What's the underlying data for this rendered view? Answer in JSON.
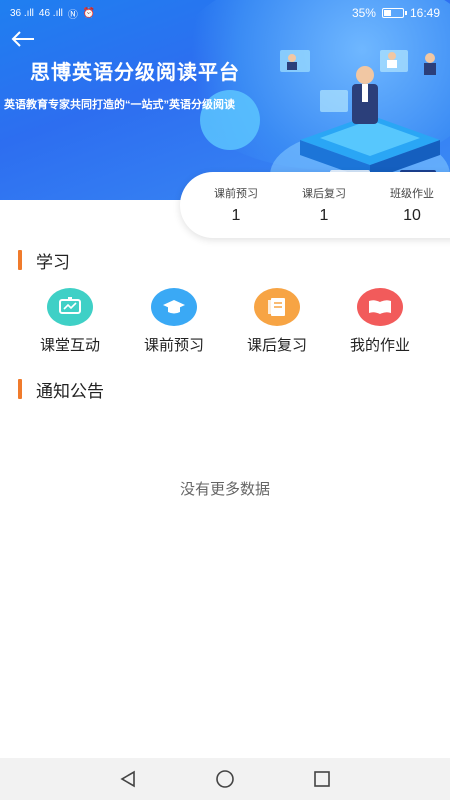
{
  "status_bar": {
    "signal_left": "36 .ıll",
    "signal_right": "46 .ıll",
    "battery_percent": "35%",
    "time": "16:49"
  },
  "banner": {
    "title": "思博英语分级阅读平台",
    "subtitle": "英语教育专家共同打造的“一站式”英语分级阅读"
  },
  "stats": [
    {
      "label": "课前预习",
      "value": "1"
    },
    {
      "label": "课后复习",
      "value": "1"
    },
    {
      "label": "班级作业",
      "value": "10"
    }
  ],
  "study_section": {
    "title": "学习",
    "modules": [
      {
        "label": "课堂互动",
        "icon": "chart-board-icon",
        "color": "#3fd0c6"
      },
      {
        "label": "课前预习",
        "icon": "graduation-cap-icon",
        "color": "#3aa9f5"
      },
      {
        "label": "课后复习",
        "icon": "notes-icon",
        "color": "#f7a444"
      },
      {
        "label": "我的作业",
        "icon": "open-book-icon",
        "color": "#f25b5b"
      }
    ]
  },
  "notice_section": {
    "title": "通知公告",
    "empty_text": "没有更多数据"
  },
  "colors": {
    "accent": "#f07b2c",
    "banner": "#2d6ef0"
  }
}
